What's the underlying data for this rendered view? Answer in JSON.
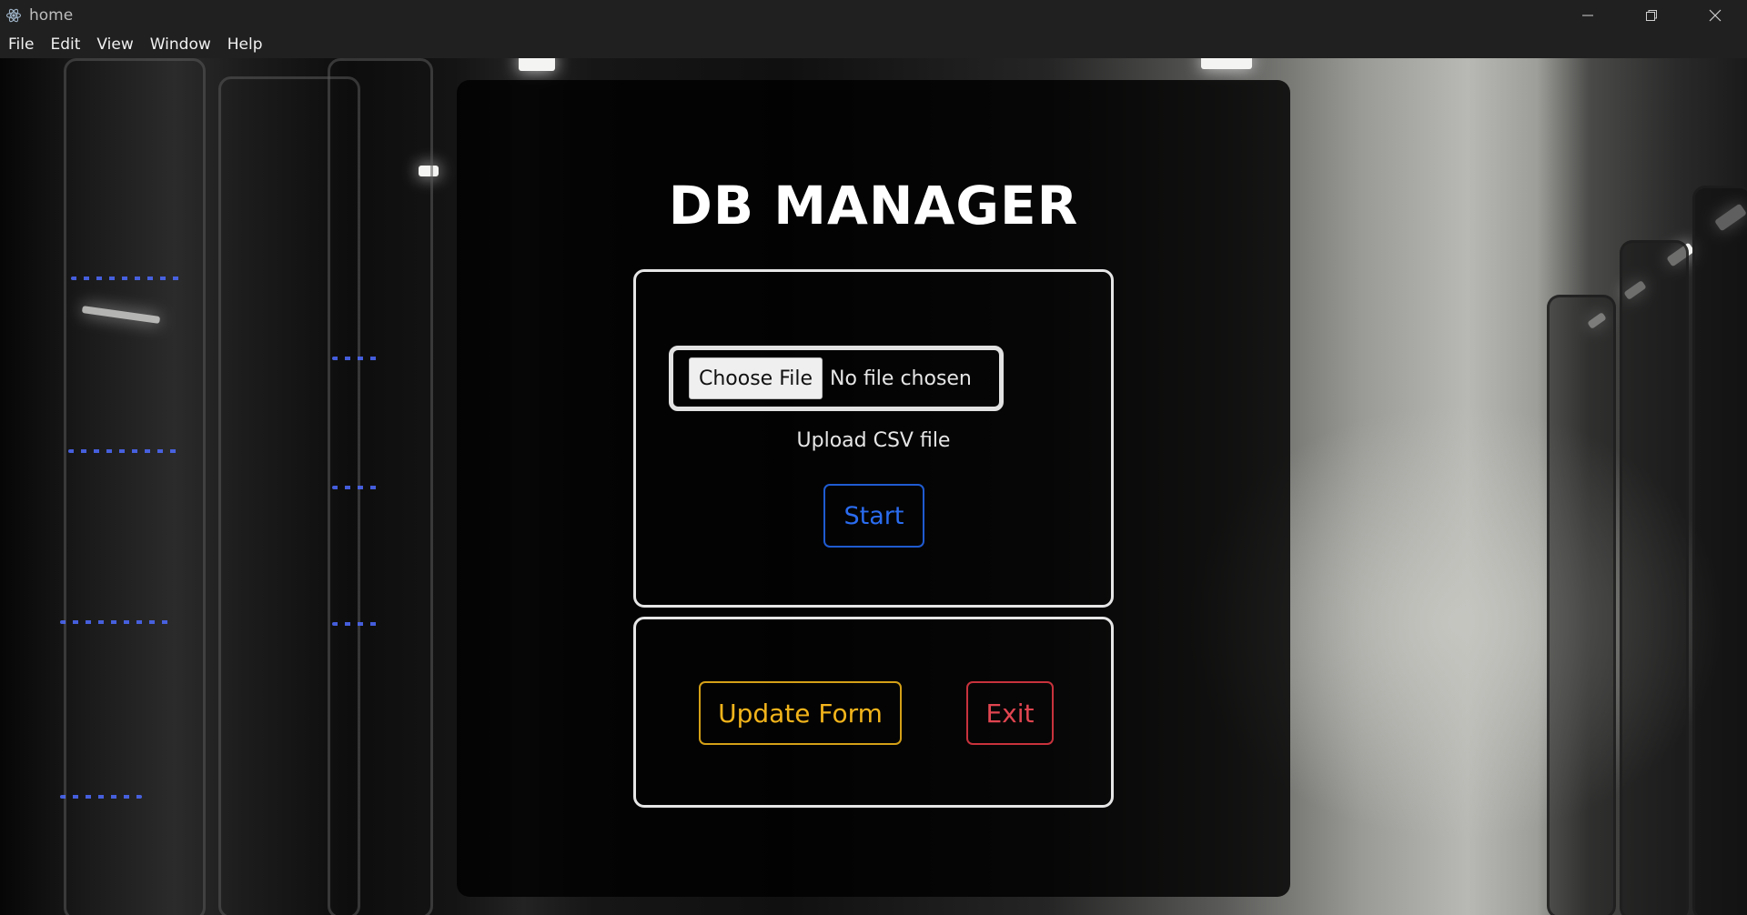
{
  "window": {
    "title": "home",
    "controls": [
      "minimize-icon",
      "restore-icon",
      "close-icon"
    ]
  },
  "menu": {
    "items": [
      "File",
      "Edit",
      "View",
      "Window",
      "Help"
    ]
  },
  "main": {
    "heading": "DB MANAGER",
    "upload": {
      "choose_file_label": "Choose File",
      "file_status": "No file chosen",
      "caption": "Upload CSV file",
      "start_label": "Start"
    },
    "actions": {
      "update_label": "Update Form",
      "exit_label": "Exit"
    }
  },
  "colors": {
    "start": "#2a6cf0",
    "update": "#f2b41b",
    "exit": "#e04550"
  }
}
